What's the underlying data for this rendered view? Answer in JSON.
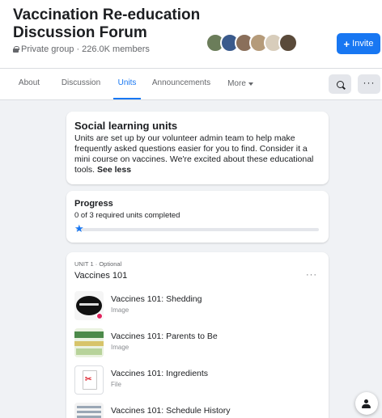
{
  "header": {
    "title": "Vaccination Re-education Discussion Forum",
    "privacy": "Private group",
    "members": "226.0K members",
    "separator": "·",
    "invite_label": "Invite",
    "invite_plus": "+",
    "member_avatar_colors": [
      "#6b7d5a",
      "#3a5a8c",
      "#8a6f5a",
      "#b59b7a",
      "#d8cdbb",
      "#5a4a3a"
    ]
  },
  "tabs": [
    {
      "label": "About",
      "active": false
    },
    {
      "label": "Discussion",
      "active": false
    },
    {
      "label": "Units",
      "active": true
    },
    {
      "label": "Announcements",
      "active": false
    },
    {
      "label": "More",
      "active": false
    }
  ],
  "toolbar": {
    "search_icon": "search-icon",
    "more_icon": "ellipsis-icon",
    "more_glyph": "···"
  },
  "intro": {
    "title": "Social learning units",
    "body": "Units are set up by our volunteer admin team to help make frequently asked questions easier for you to find. Consider it a mini course on vaccines. We're excited about these educational tools.",
    "see_less": "See less"
  },
  "progress": {
    "title": "Progress",
    "status": "0 of 3 required units completed",
    "completed": 0,
    "required": 3,
    "marker_glyph": "★"
  },
  "unit": {
    "label": "UNIT 1",
    "separator": "·",
    "tag": "Optional",
    "title": "Vaccines 101",
    "more_glyph": "···",
    "items": [
      {
        "title": "Vaccines 101: Shedding",
        "type": "Image",
        "thumb": "image-thumbnail"
      },
      {
        "title": "Vaccines 101: Parents to Be",
        "type": "Image",
        "thumb": "image-thumbnail"
      },
      {
        "title": "Vaccines 101: Ingredients",
        "type": "File",
        "thumb": "pdf-file-icon"
      },
      {
        "title": "Vaccines 101: Schedule History",
        "type": "",
        "thumb": "image-thumbnail"
      }
    ]
  },
  "colors": {
    "accent": "#1877f2",
    "background": "#f0f2f5",
    "text_secondary": "#65676b"
  }
}
